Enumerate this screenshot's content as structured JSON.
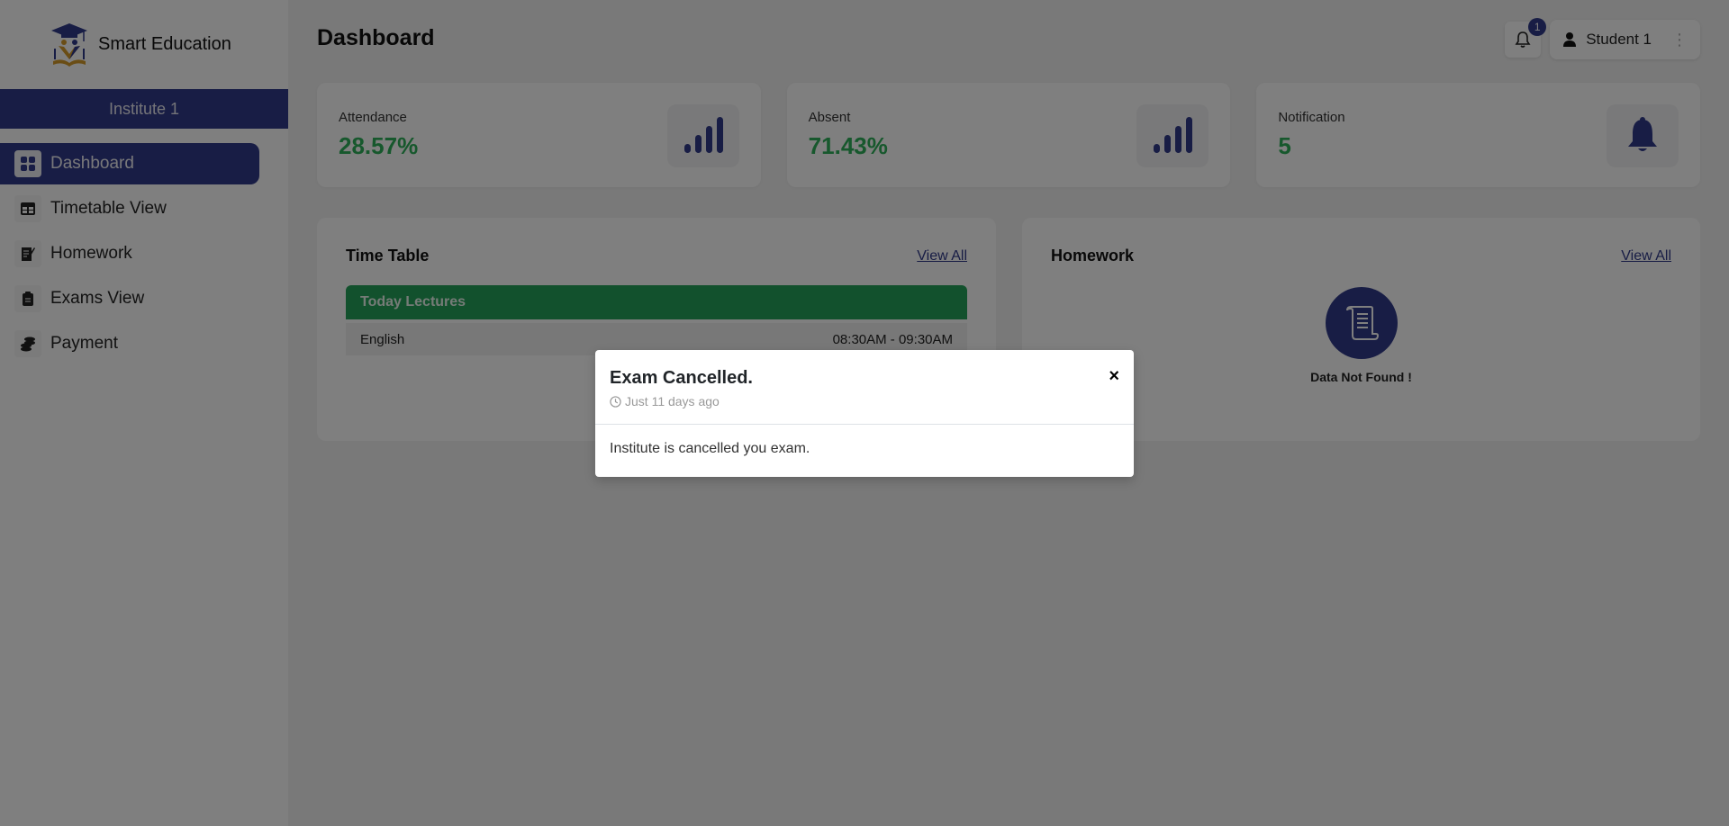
{
  "sidebar": {
    "app_name": "Smart Education",
    "institute": "Institute 1",
    "items": [
      {
        "label": "Dashboard",
        "icon": "dashboard-grid-icon",
        "active": true
      },
      {
        "label": "Timetable View",
        "icon": "table-icon",
        "active": false
      },
      {
        "label": "Homework",
        "icon": "homework-note-icon",
        "active": false
      },
      {
        "label": "Exams View",
        "icon": "clipboard-icon",
        "active": false
      },
      {
        "label": "Payment",
        "icon": "coins-icon",
        "active": false
      }
    ]
  },
  "header": {
    "title": "Dashboard",
    "notification_count": "1",
    "user_name": "Student 1",
    "kebab": "⋮"
  },
  "stats": [
    {
      "label": "Attendance",
      "value": "28.57%",
      "icon": "signal-bars-icon"
    },
    {
      "label": "Absent",
      "value": "71.43%",
      "icon": "signal-bars-icon"
    },
    {
      "label": "Notification",
      "value": "5",
      "icon": "bell-icon"
    }
  ],
  "timetable": {
    "title": "Time Table",
    "view_all": "View All",
    "section_label": "Today Lectures",
    "lectures": [
      {
        "subject": "English",
        "time": "08:30AM - 09:30AM"
      }
    ]
  },
  "homework": {
    "title": "Homework",
    "view_all": "View All",
    "empty_text": "Data Not Found !"
  },
  "modal": {
    "title": "Exam Cancelled.",
    "time": "Just 11 days ago",
    "body": "Institute is cancelled you exam.",
    "close": "×"
  },
  "colors": {
    "brand": "#303a8a",
    "success": "#25a35a"
  }
}
